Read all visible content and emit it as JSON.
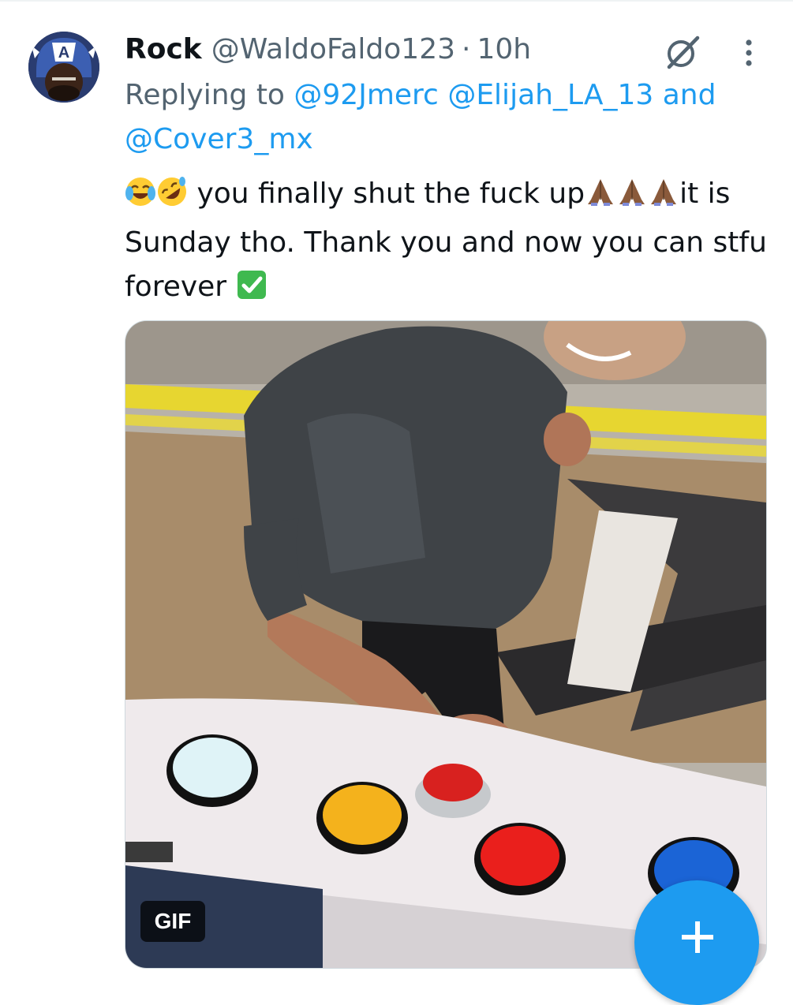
{
  "tweet": {
    "display_name": "Rock",
    "handle": "@WaldoFaldo123",
    "separator": "·",
    "time": "10h",
    "reply": {
      "prefix": "Replying to ",
      "mention_1": "@92Jmerc",
      "mention_2": "@Elijah_LA_13",
      "joiner": " and",
      "mention_3": "@Cover3_mx"
    },
    "text": {
      "part_1": " you finally shut the fuck up",
      "part_2": "it is Sunday tho. Thank you and now you can stfu forever "
    },
    "emojis": {
      "joy": "face-with-tears-of-joy-icon",
      "rofl": "rolling-on-floor-laughing-icon",
      "pray": "folded-hands-icon",
      "check": "check-mark-button-icon"
    },
    "media": {
      "badge": "GIF"
    }
  },
  "icons": {
    "grok": "grok-icon",
    "more": "more-options-icon",
    "compose": "plus-icon"
  },
  "colors": {
    "accent": "#1d9bf0",
    "text_primary": "#0f1419",
    "text_secondary": "#536471",
    "check_green": "#3fb94f"
  }
}
